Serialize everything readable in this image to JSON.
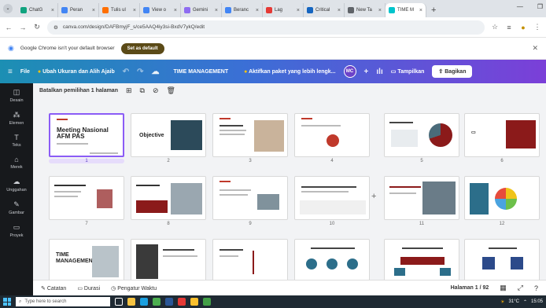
{
  "browser": {
    "tabs": [
      {
        "label": "ChatG",
        "color": "#10a37f"
      },
      {
        "label": "Peran",
        "color": "#4285f4"
      },
      {
        "label": "Tulis ul",
        "color": "#ff6f00"
      },
      {
        "label": "View o",
        "color": "#4285f4"
      },
      {
        "label": "Gemini",
        "color": "#8e6cf1"
      },
      {
        "label": "Beranc",
        "color": "#4285f4"
      },
      {
        "label": "Lag",
        "color": "#e53935"
      },
      {
        "label": "Critical",
        "color": "#1565c0"
      },
      {
        "label": "New Ta",
        "color": "#5f6368"
      },
      {
        "label": "TIME M",
        "color": "#00c4cc",
        "active": true
      }
    ],
    "new_tab_label": "+",
    "url": "canva.com/design/DAFBmyjF_s/ce5AAQ4iy3si-BxdV7ykQ/edit",
    "infobar_text": "Google Chrome isn't your default browser",
    "set_default_label": "Set as default"
  },
  "canva": {
    "file_label": "File",
    "resize_label": "Ubah Ukuran dan Alih Ajaib",
    "doc_title": "TIME MANAGEMENT",
    "promo_label": "Aktifkan paket yang lebih lengk...",
    "avatar_initials": "MC",
    "present_label": "Tampilkan",
    "share_label": "Bagikan"
  },
  "rail": [
    {
      "label": "Desain",
      "icon": "layout-icon",
      "glyph": "◫"
    },
    {
      "label": "Elemen",
      "icon": "elements-icon",
      "glyph": "⁂"
    },
    {
      "label": "Teks",
      "icon": "text-icon",
      "glyph": "T"
    },
    {
      "label": "Merek",
      "icon": "brand-icon",
      "glyph": "⌂"
    },
    {
      "label": "Unggahan",
      "icon": "upload-icon",
      "glyph": "☁"
    },
    {
      "label": "Gambar",
      "icon": "draw-icon",
      "glyph": "✎"
    },
    {
      "label": "Proyek",
      "icon": "folder-icon",
      "glyph": "▭"
    }
  ],
  "selection": {
    "label": "Batalkan pemilihan 1 halaman"
  },
  "slides": [
    {
      "num": "1",
      "title": "Meeting Nasional AFM PAS"
    },
    {
      "num": "2",
      "title": "Objective"
    },
    {
      "num": "3",
      "title": ""
    },
    {
      "num": "4",
      "title": ""
    },
    {
      "num": "5",
      "title": ""
    },
    {
      "num": "6",
      "title": ""
    },
    {
      "num": "7",
      "title": ""
    },
    {
      "num": "8",
      "title": ""
    },
    {
      "num": "9",
      "title": ""
    },
    {
      "num": "10",
      "title": ""
    },
    {
      "num": "11",
      "title": ""
    },
    {
      "num": "12",
      "title": ""
    },
    {
      "num": "",
      "title": "TIME MANAGEMENT"
    },
    {
      "num": "",
      "title": ""
    },
    {
      "num": "",
      "title": ""
    },
    {
      "num": "",
      "title": ""
    },
    {
      "num": "",
      "title": ""
    },
    {
      "num": "",
      "title": ""
    }
  ],
  "bottom": {
    "notes_label": "Catatan",
    "duration_label": "Durasi",
    "timer_label": "Pengatur Waktu",
    "page_label": "Halaman 1 / 92"
  },
  "taskbar": {
    "search_placeholder": "Type here to search",
    "temperature": "31°C",
    "time": "15:05"
  }
}
